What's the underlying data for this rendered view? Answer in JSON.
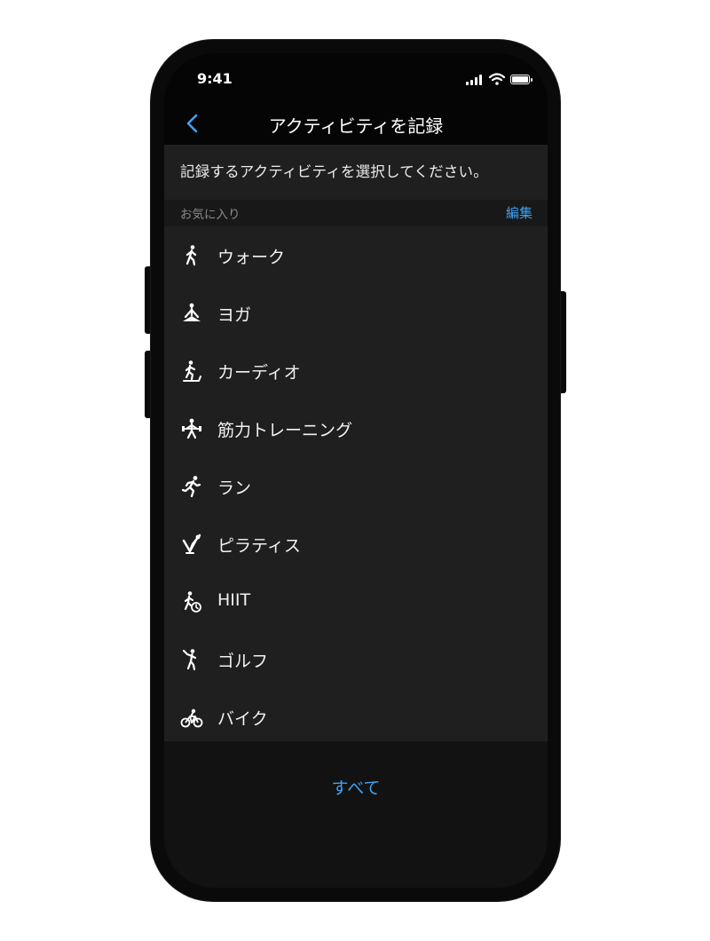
{
  "status_bar": {
    "time": "9:41"
  },
  "nav": {
    "title": "アクティビティを記録",
    "back_icon": "chevron-left-icon"
  },
  "prompt": "記録するアクティビティを選択してください。",
  "favorites": {
    "label": "お気に入り",
    "edit_label": "編集"
  },
  "activities": [
    {
      "label": "ウォーク",
      "icon": "walk-icon"
    },
    {
      "label": "ヨガ",
      "icon": "yoga-icon"
    },
    {
      "label": "カーディオ",
      "icon": "cardio-icon"
    },
    {
      "label": "筋力トレーニング",
      "icon": "strength-training-icon"
    },
    {
      "label": "ラン",
      "icon": "run-icon"
    },
    {
      "label": "ピラティス",
      "icon": "pilates-icon"
    },
    {
      "label": "HIIT",
      "icon": "hiit-icon"
    },
    {
      "label": "ゴルフ",
      "icon": "golf-icon"
    },
    {
      "label": "バイク",
      "icon": "bike-icon"
    }
  ],
  "all_button": "すべて",
  "colors": {
    "accent": "#3ea2f4",
    "list_bg": "#1f1f1f",
    "screen_bg": "#050505"
  }
}
